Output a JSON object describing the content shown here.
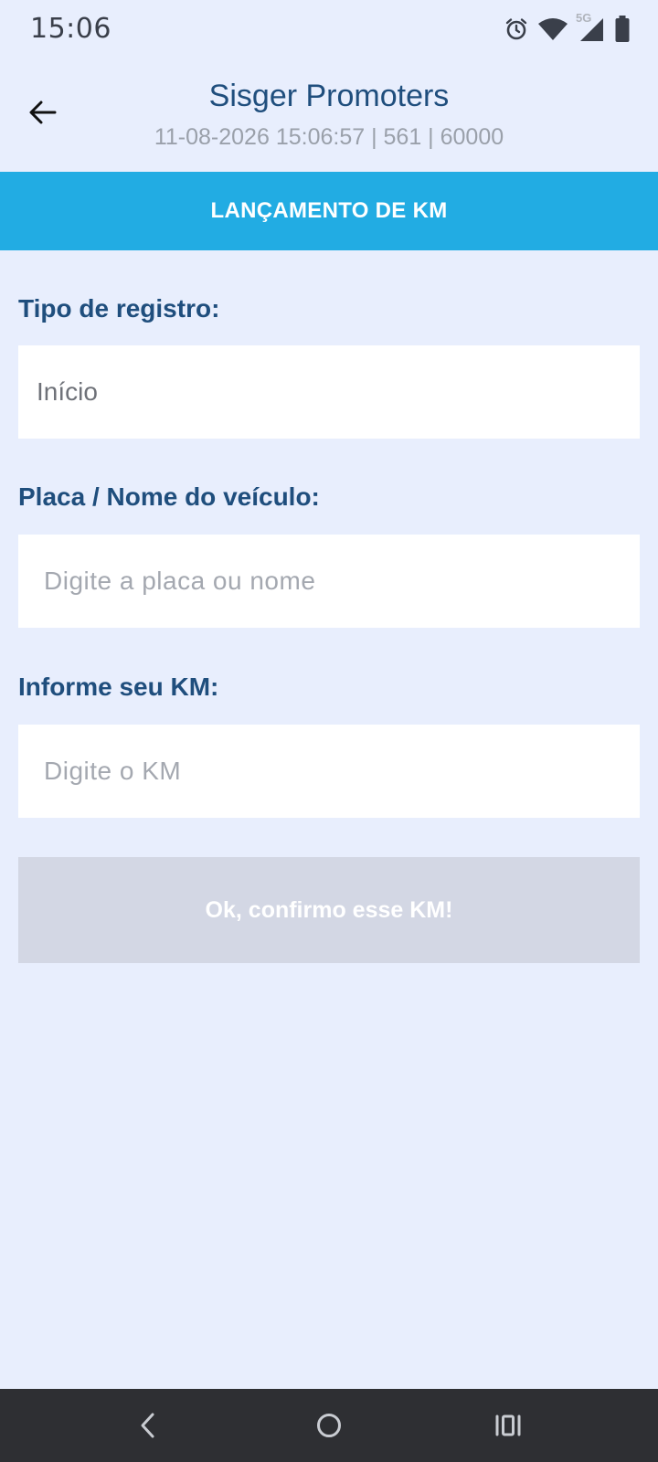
{
  "status_bar": {
    "time": "15:06",
    "network_label": "5G",
    "icons": [
      "alarm-icon",
      "wifi-icon",
      "cellular-signal-icon",
      "battery-icon"
    ]
  },
  "header": {
    "back_icon": "arrow-left-icon",
    "title": "Sisger Promoters",
    "subtitle": "11-08-2026 15:06:57 | 561 | 60000"
  },
  "banner": {
    "title": "LANÇAMENTO DE KM"
  },
  "form": {
    "tipo_registro": {
      "label": "Tipo de registro:",
      "value": "Início"
    },
    "veiculo": {
      "label": "Placa / Nome do veículo:",
      "placeholder": "Digite a placa ou nome",
      "value": ""
    },
    "km": {
      "label": "Informe seu KM:",
      "placeholder": "Digite o KM",
      "value": ""
    },
    "confirm_label": "Ok, confirmo esse KM!"
  },
  "nav_bar": {
    "icons": [
      "back-nav-icon",
      "home-nav-icon",
      "recents-nav-icon"
    ]
  },
  "colors": {
    "background": "#e8eefd",
    "banner": "#22ace3",
    "label": "#1f4e7d",
    "button_disabled": "#d3d7e4",
    "nav_bar": "#2e2f33"
  }
}
